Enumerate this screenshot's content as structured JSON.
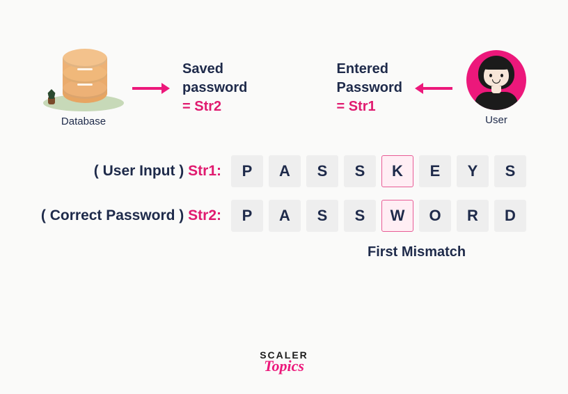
{
  "top": {
    "database_caption": "Database",
    "saved_line1": "Saved",
    "saved_line2": "password",
    "saved_eq": "= Str2",
    "entered_line1": "Entered",
    "entered_line2": "Password",
    "entered_eq": "= Str1",
    "user_caption": "User"
  },
  "rows": {
    "row1": {
      "paren": "( User Input )",
      "str": "Str1:",
      "cells": [
        "P",
        "A",
        "S",
        "S",
        "K",
        "E",
        "Y",
        "S"
      ],
      "mismatch_index": 4
    },
    "row2": {
      "paren": "( Correct Password )",
      "str": "Str2:",
      "cells": [
        "P",
        "A",
        "S",
        "S",
        "W",
        "O",
        "R",
        "D"
      ],
      "mismatch_index": 4
    },
    "mismatch_label": "First Mismatch"
  },
  "logo": {
    "line1": "SCALER",
    "line2": "Topics"
  },
  "colors": {
    "accent": "#ec187b",
    "text": "#1e2a4a",
    "cell_bg": "#eeeeee"
  }
}
